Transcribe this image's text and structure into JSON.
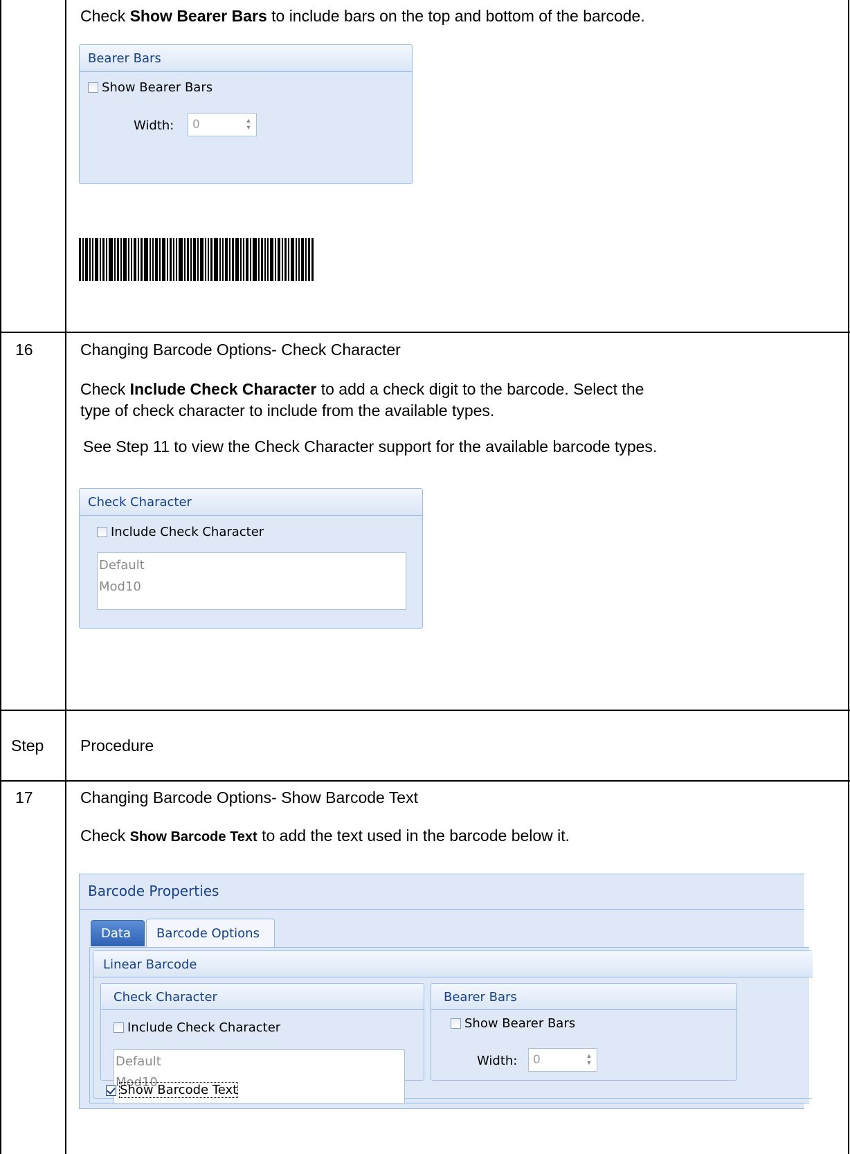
{
  "row15": {
    "text_pre": "Check ",
    "text_bold": "Show Bearer Bars",
    "text_post": " to include bars on the top and bottom of the barcode.",
    "bearer_group": {
      "title": "Bearer Bars",
      "checkbox_label": "Show Bearer Bars",
      "width_label": "Width:",
      "width_value": "0"
    }
  },
  "row16": {
    "number": "16",
    "heading": "Changing Barcode Options- Check Character",
    "para1_pre": "Check ",
    "para1_bold": "Include Check Character",
    "para1_line1_post": " to add a check digit to the barcode. Select the",
    "para1_line2": "type of check character to include from the available types.",
    "para2": "See Step 11 to view the Check Character support for the available barcode types.",
    "check_group": {
      "title": "Check Character",
      "checkbox_label": "Include Check Character",
      "options": [
        "Default",
        "Mod10"
      ]
    }
  },
  "header_row": {
    "step": "Step",
    "procedure": "Procedure"
  },
  "row17": {
    "number": "17",
    "heading": "Changing Barcode Options- Show Barcode Text",
    "para_pre": "Check ",
    "para_bold": "Show Barcode Text",
    "para_post": " to add the text used in the barcode below it.",
    "dialog": {
      "title": "Barcode Properties",
      "tabs": [
        "Data",
        "Barcode Options"
      ],
      "section": "Linear Barcode",
      "check_group": {
        "title": "Check Character",
        "checkbox_label": "Include Check Character",
        "options": [
          "Default",
          "Mod10"
        ]
      },
      "bearer_group": {
        "title": "Bearer Bars",
        "checkbox_label": "Show Bearer Bars",
        "width_label": "Width:",
        "width_value": "0"
      },
      "show_text_label": "Show Barcode Text",
      "show_text_checked": true
    }
  },
  "colors": {
    "group_bg": "#dfe8f6",
    "group_border": "#99bbe8",
    "title_text": "#15428b"
  }
}
